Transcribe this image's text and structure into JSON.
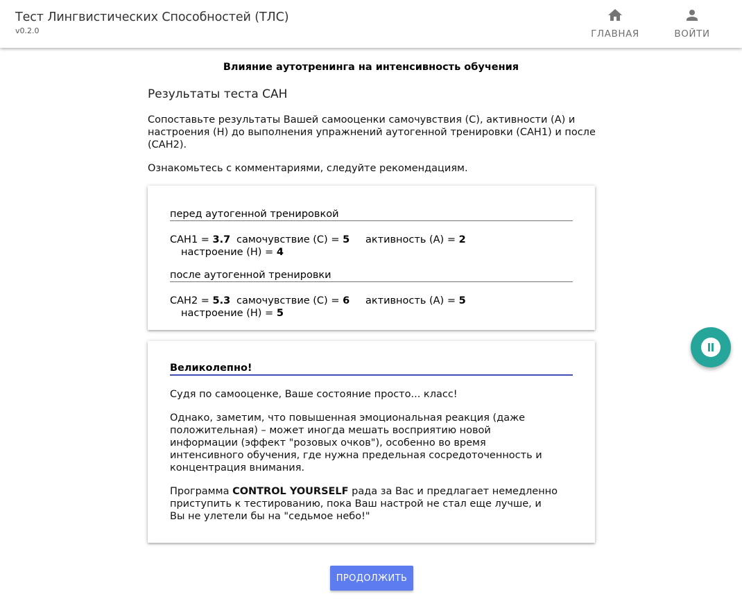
{
  "app": {
    "title": "Тест Лингвистических Способностей (ТЛС)",
    "version": "v0.2.0"
  },
  "nav": {
    "home": {
      "label": "ГЛАВНАЯ",
      "icon": "home-icon"
    },
    "login": {
      "label": "ВОЙТИ",
      "icon": "person-icon"
    }
  },
  "page": {
    "heading": "Влияние аутотренинга на интенсивность обучения",
    "section_title": "Результаты теста САН",
    "intro_1": "Сопоставьте результаты Вашей самооценки самочувствия (С), активности (А) и настроения (Н) до выполнения упражнений аутогенной тренировки (САН1) и после (САН2).",
    "intro_2": "Ознакомьтесь с комментариями, следуйте рекомендациям."
  },
  "results": {
    "before": {
      "label": "перед аутогенной тренировкой",
      "san_label": "САН1 = ",
      "san_value": "3.7",
      "wellbeing_label": "самочувствие (С) = ",
      "wellbeing_value": "5",
      "activity_label": "активность (А) = ",
      "activity_value": "2",
      "mood_label": "настроение (Н) = ",
      "mood_value": "4"
    },
    "after": {
      "label": "после аутогенной тренировки",
      "san_label": "САН2 = ",
      "san_value": "5.3",
      "wellbeing_label": "самочувствие (С) = ",
      "wellbeing_value": "6",
      "activity_label": "активность (А) = ",
      "activity_value": "5",
      "mood_label": "настроение (Н) = ",
      "mood_value": "5"
    }
  },
  "verdict": {
    "title": "Великолепно!",
    "p1": "Судя по самооценке, Ваше состояние просто... класс!",
    "p2": "Однако, заметим, что повышенная эмоциональная реакция (даже положительная) – может иногда мешать восприятию новой информации (эффект \"розовых очков\"), особенно во время интенсивного обучения, где нужна предельная сосредоточенность и концентрация внимания.",
    "p3_before": "Программа ",
    "p3_bold": "CONTROL YOURSELF",
    "p3_after": " рада за Вас и предлагает немедленно приступить к тестированию, пока Ваш настрой не стал еще лучше, и Вы не улетели бы на \"седьмое небо!\""
  },
  "actions": {
    "continue_label": "ПРОДОЛЖИТЬ",
    "fab_icon": "pause-icon"
  },
  "colors": {
    "accent_blue": "#5c7cf0",
    "fab_teal": "#26a69a",
    "verdict_underline": "#3f51b5"
  }
}
